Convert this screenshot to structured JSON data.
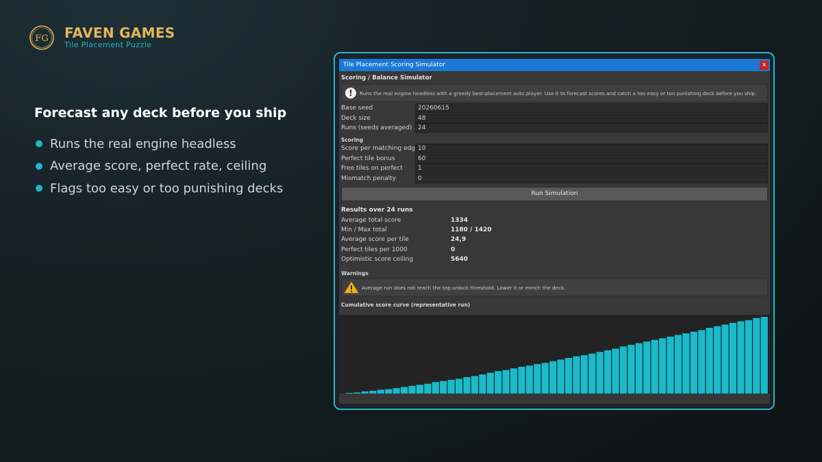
{
  "brand": {
    "title": "FAVEN GAMES",
    "subtitle": "Tile Placement Puzzle",
    "logo_monogram": "FG"
  },
  "headline": "Forecast any deck before you ship",
  "bullets": [
    "Runs the real engine headless",
    "Average score, perfect rate, ceiling",
    "Flags too easy or too punishing decks"
  ],
  "window": {
    "title": "Tile Placement Scoring Simulator",
    "close_label": "x",
    "section_title": "Scoring / Balance Simulator",
    "info_text": "Runs the real engine headless with a greedy best-placement auto player. Use it to forecast scores and catch a too easy or too punishing deck before you ship.",
    "fields": [
      {
        "label": "Base seed",
        "value": "20260615"
      },
      {
        "label": "Deck size",
        "value": "48"
      },
      {
        "label": "Runs (seeds averaged)",
        "value": "24"
      }
    ],
    "scoring_title": "Scoring",
    "scoring_fields": [
      {
        "label": "Score per matching edge",
        "value": "10"
      },
      {
        "label": "Perfect tile bonus",
        "value": "60"
      },
      {
        "label": "Free tiles on perfect",
        "value": "1"
      },
      {
        "label": "Mismatch penalty",
        "value": "0"
      }
    ],
    "run_button": "Run Simulation",
    "results_title": "Results over 24 runs",
    "results": [
      {
        "label": "Average total score",
        "value": "1334"
      },
      {
        "label": "Min / Max total",
        "value": "1180 / 1420"
      },
      {
        "label": "Average score per tile",
        "value": "24,9"
      },
      {
        "label": "Perfect tiles per 1000",
        "value": "0"
      },
      {
        "label": "Optimistic score ceiling",
        "value": "5640"
      }
    ],
    "warnings_title": "Warnings",
    "warning_text": "Average run does not reach the top unlock threshold. Lower it or enrich the deck.",
    "curve_title": "Cumulative score curve (representative run)"
  },
  "colors": {
    "accent": "#22b7c8",
    "brand_gold": "#e3b65a",
    "titlebar": "#1b78d4",
    "bar": "#19bac9"
  },
  "icons": {
    "info": "exclamation-circle-icon",
    "warning": "warning-triangle-icon",
    "close": "close-icon"
  },
  "chart_data": {
    "type": "bar",
    "title": "Cumulative score curve (representative run)",
    "xlabel": "",
    "ylabel": "",
    "ylim": [
      0,
      1400
    ],
    "values": [
      10,
      20,
      40,
      50,
      70,
      80,
      100,
      120,
      140,
      160,
      180,
      210,
      230,
      250,
      270,
      300,
      320,
      350,
      380,
      410,
      430,
      460,
      490,
      510,
      540,
      560,
      590,
      620,
      650,
      680,
      700,
      730,
      760,
      790,
      820,
      860,
      890,
      920,
      950,
      980,
      1010,
      1040,
      1070,
      1100,
      1130,
      1160,
      1200,
      1230,
      1260,
      1290,
      1320,
      1340,
      1380,
      1400
    ]
  }
}
